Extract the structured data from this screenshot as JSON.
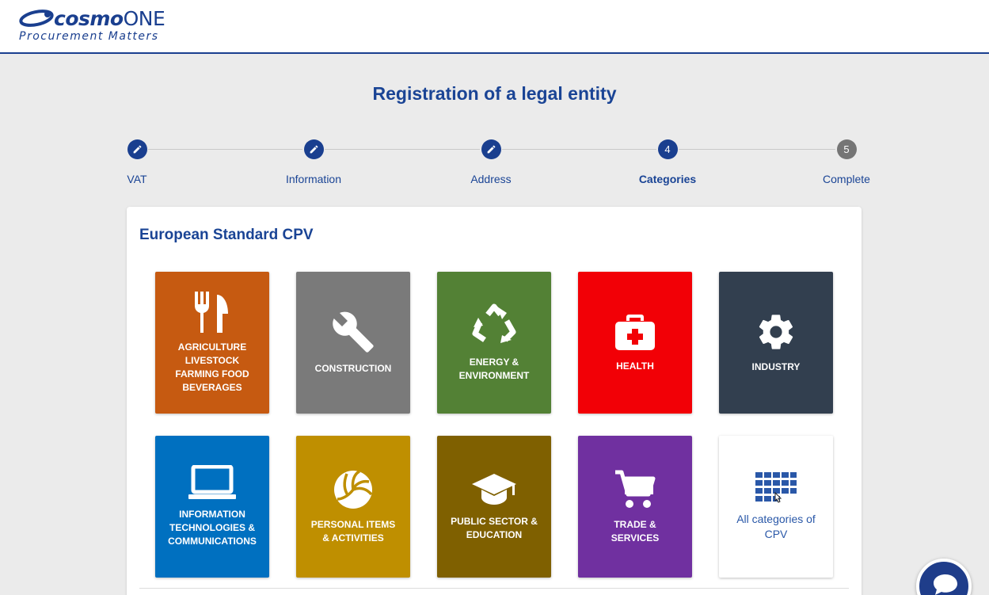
{
  "app": {
    "logo_brand": "cosmoONE",
    "logo_brand_main": "cosmo",
    "logo_brand_suffix": "ONE",
    "logo_tagline": "Procurement Matters",
    "brand_color": "#1a3f8f"
  },
  "page": {
    "title": "Registration of a legal entity"
  },
  "stepper": {
    "steps": [
      {
        "label": "VAT",
        "state": "done",
        "marker": "pencil-icon"
      },
      {
        "label": "Information",
        "state": "done",
        "marker": "pencil-icon"
      },
      {
        "label": "Address",
        "state": "done",
        "marker": "pencil-icon"
      },
      {
        "label": "Categories",
        "state": "active",
        "number": "4"
      },
      {
        "label": "Complete",
        "state": "todo",
        "number": "5"
      }
    ]
  },
  "cpv": {
    "title": "European Standard CPV",
    "tiles": [
      {
        "label": "AGRICULTURE LIVESTOCK FARMING FOOD BEVERAGES",
        "icon": "fork-knife-icon",
        "color": "#c65a11"
      },
      {
        "label": "CONSTRUCTION",
        "icon": "wrench-icon",
        "color": "#7a7a7a"
      },
      {
        "label": "ENERGY & ENVIRONMENT",
        "icon": "recycle-icon",
        "color": "#538135"
      },
      {
        "label": "HEALTH",
        "icon": "first-aid-kit-icon",
        "color": "#f20006"
      },
      {
        "label": "INDUSTRY",
        "icon": "gear-icon",
        "color": "#323f4f"
      },
      {
        "label": "INFORMATION TECHNOLOGIES & COMMUNICATIONS",
        "icon": "laptop-icon",
        "color": "#0070c0"
      },
      {
        "label": "PERSONAL ITEMS & ACTIVITIES",
        "icon": "volleyball-icon",
        "color": "#bf8f00"
      },
      {
        "label": "PUBLIC SECTOR & EDUCATION",
        "icon": "graduation-cap-icon",
        "color": "#7f6000"
      },
      {
        "label": "TRADE & SERVICES",
        "icon": "shopping-cart-icon",
        "color": "#7030a0"
      },
      {
        "label": "All categories of CPV",
        "icon": "grid-icon",
        "color": "#ffffff"
      }
    ]
  },
  "chat": {
    "icon": "chat-bubble-icon"
  }
}
